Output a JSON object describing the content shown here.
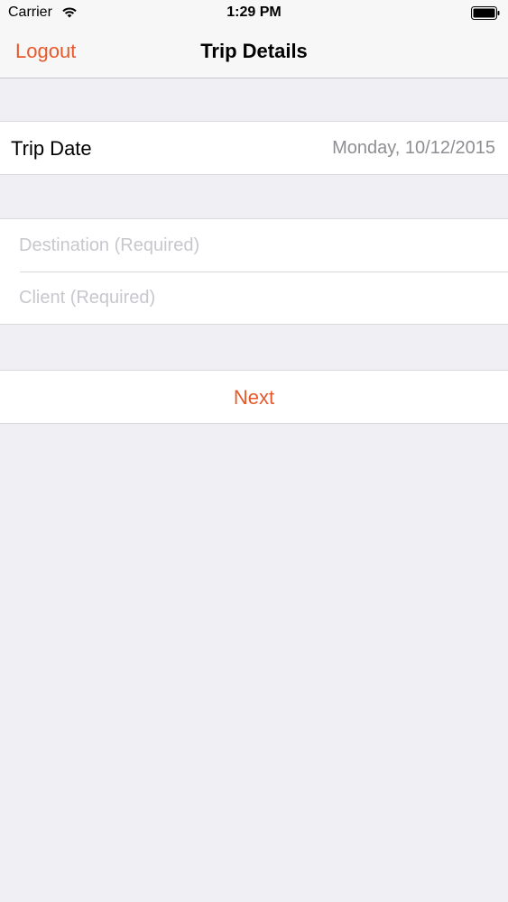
{
  "status_bar": {
    "carrier": "Carrier",
    "time": "1:29 PM",
    "icons": [
      "wifi-icon",
      "battery-icon"
    ]
  },
  "nav": {
    "left_button": "Logout",
    "title": "Trip Details"
  },
  "trip_date": {
    "label": "Trip Date",
    "value": "Monday, 10/12/2015"
  },
  "fields": {
    "destination": {
      "value": "",
      "placeholder": "Destination (Required)"
    },
    "client": {
      "value": "",
      "placeholder": "Client (Required)"
    }
  },
  "actions": {
    "next_label": "Next"
  },
  "colors": {
    "accent": "#e8582a",
    "background": "#efeff4",
    "secondary_text": "#8e8e93"
  }
}
